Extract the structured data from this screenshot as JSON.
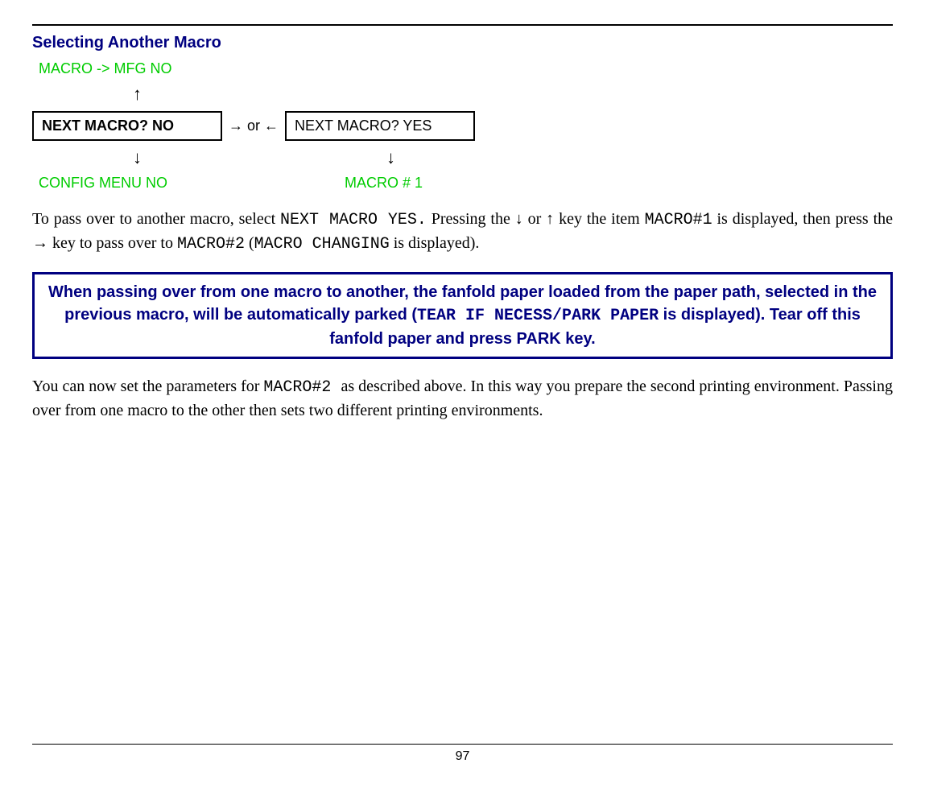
{
  "title": "Selecting Another Macro",
  "diagram": {
    "top_green": "MACRO -> MFG NO",
    "arrow_up": "↑",
    "left_box": "NEXT MACRO? NO",
    "or_label": "→ or ←",
    "right_box": "NEXT MACRO? YES",
    "arrow_down_left": "↓",
    "arrow_down_right": "↓",
    "bottom_left_green": "CONFIG MENU NO",
    "bottom_right_green": "MACRO # 1"
  },
  "para1": {
    "t1": "To pass over to another macro, select ",
    "code1": " NEXT MACRO YES.",
    "t2": " Pressing the ↓ or ↑ key the item ",
    "code2": "MACRO#1",
    "t3": " is displayed, then press the → key to pass over to ",
    "code3": "MACRO#2",
    "t4": " (",
    "code4": "MACRO CHANGING",
    "t5": "  is displayed)."
  },
  "note": {
    "t1": "When passing over from one macro to another, the fanfold paper loaded from the paper path, selected in the previous macro, will be automatically parked (",
    "code1": "TEAR IF NECESS/PARK PAPER",
    "t2": " is displayed). Tear off this fanfold paper and press PARK key."
  },
  "para2": {
    "t1": "You can now set the parameters for ",
    "code1": "MACRO#2 ",
    "t2": " as described above. In this way you prepare the second printing environment. Passing over from one macro to the other then sets two different printing environments."
  },
  "page_number": "97"
}
